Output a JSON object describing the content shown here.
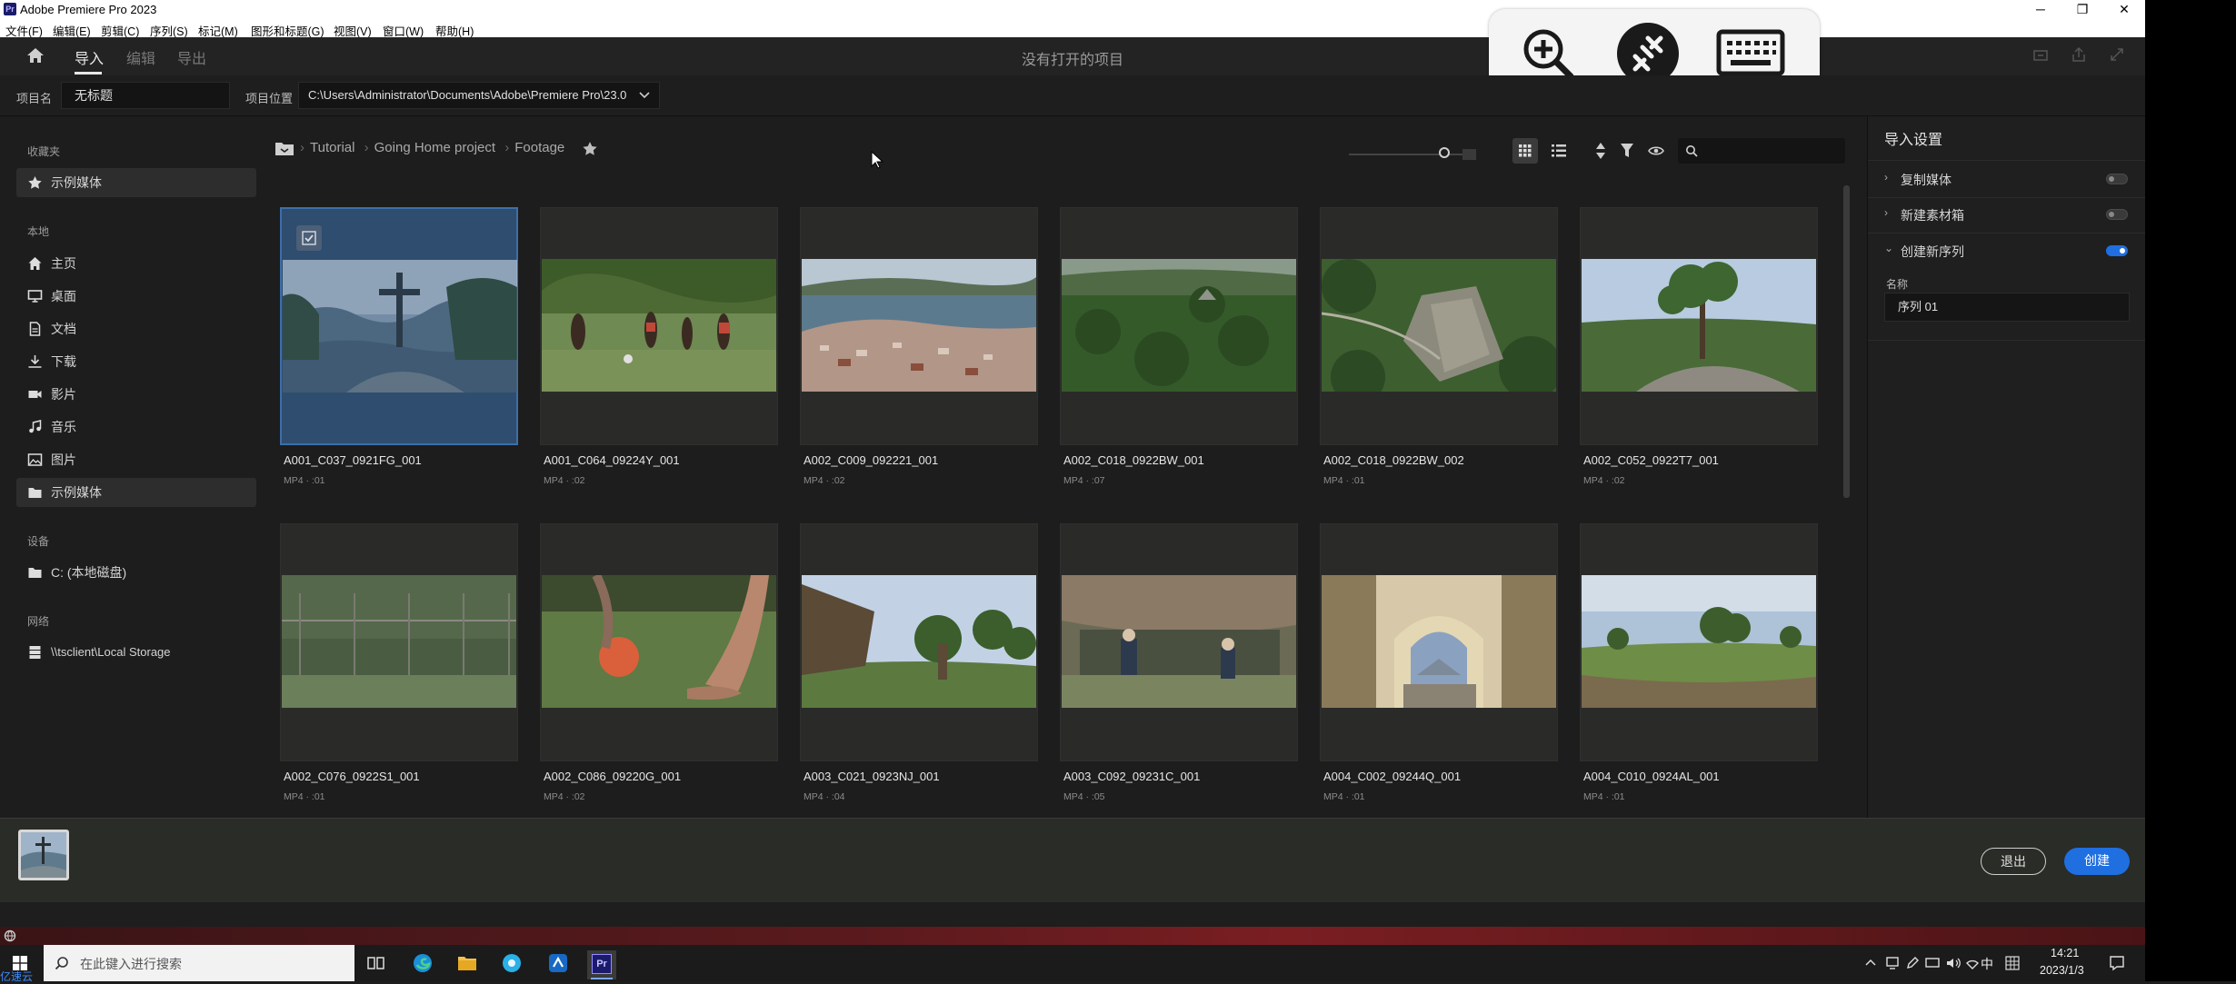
{
  "window": {
    "title": "Adobe Premiere Pro 2023",
    "app_icon": "Pr"
  },
  "menu": [
    "文件(F)",
    "编辑(E)",
    "剪辑(C)",
    "序列(S)",
    "标记(M)",
    "图形和标题(G)",
    "视图(V)",
    "窗口(W)",
    "帮助(H)"
  ],
  "header": {
    "tabs": [
      "导入",
      "编辑",
      "导出"
    ],
    "status": "没有打开的项目"
  },
  "project": {
    "name_label": "项目名",
    "name_value": "无标题",
    "location_label": "项目位置",
    "location_value": "C:\\Users\\Administrator\\Documents\\Adobe\\Premiere Pro\\23.0"
  },
  "sidebar": {
    "favorites_label": "收藏夹",
    "favorites": [
      {
        "label": "示例媒体",
        "icon": "star-icon"
      }
    ],
    "local_label": "本地",
    "local": [
      {
        "label": "主页",
        "icon": "home-icon"
      },
      {
        "label": "桌面",
        "icon": "monitor-icon"
      },
      {
        "label": "文档",
        "icon": "document-icon"
      },
      {
        "label": "下载",
        "icon": "download-icon"
      },
      {
        "label": "影片",
        "icon": "video-icon"
      },
      {
        "label": "音乐",
        "icon": "music-icon"
      },
      {
        "label": "图片",
        "icon": "image-icon"
      },
      {
        "label": "示例媒体",
        "icon": "folder-icon"
      }
    ],
    "devices_label": "设备",
    "devices": [
      {
        "label": "C: (本地磁盘)",
        "icon": "folder-icon"
      }
    ],
    "network_label": "网络",
    "network": [
      {
        "label": "\\\\tsclient\\Local Storage",
        "icon": "storage-icon"
      }
    ]
  },
  "breadcrumb": [
    "Tutorial",
    "Going Home project",
    "Footage"
  ],
  "media": [
    {
      "name": "A001_C037_0921FG_001",
      "meta": "MP4 · :01"
    },
    {
      "name": "A001_C064_09224Y_001",
      "meta": "MP4 · :02"
    },
    {
      "name": "A002_C009_092221_001",
      "meta": "MP4 · :02"
    },
    {
      "name": "A002_C018_0922BW_001",
      "meta": "MP4 · :07"
    },
    {
      "name": "A002_C018_0922BW_002",
      "meta": "MP4 · :01"
    },
    {
      "name": "A002_C052_0922T7_001",
      "meta": "MP4 · :02"
    },
    {
      "name": "A002_C076_0922S1_001",
      "meta": "MP4 · :01"
    },
    {
      "name": "A002_C086_09220G_001",
      "meta": "MP4 · :02"
    },
    {
      "name": "A003_C021_0923NJ_001",
      "meta": "MP4 · :04"
    },
    {
      "name": "A003_C092_09231C_001",
      "meta": "MP4 · :05"
    },
    {
      "name": "A004_C002_09244Q_001",
      "meta": "MP4 · :01"
    },
    {
      "name": "A004_C010_0924AL_001",
      "meta": "MP4 · :01"
    }
  ],
  "import_settings": {
    "title": "导入设置",
    "rows": [
      {
        "label": "复制媒体",
        "on": false
      },
      {
        "label": "新建素材箱",
        "on": false
      },
      {
        "label": "创建新序列",
        "on": true
      }
    ],
    "name_label": "名称",
    "name_value": "序列 01"
  },
  "buttons": {
    "exit": "退出",
    "create": "创建"
  },
  "taskbar": {
    "search_placeholder": "在此键入进行搜索",
    "time": "14:21",
    "date": "2023/1/3",
    "ime": "中",
    "corner_text": "亿速云"
  },
  "colors": {
    "accent": "#1f6fe0",
    "selection": "#2e4d6f"
  }
}
